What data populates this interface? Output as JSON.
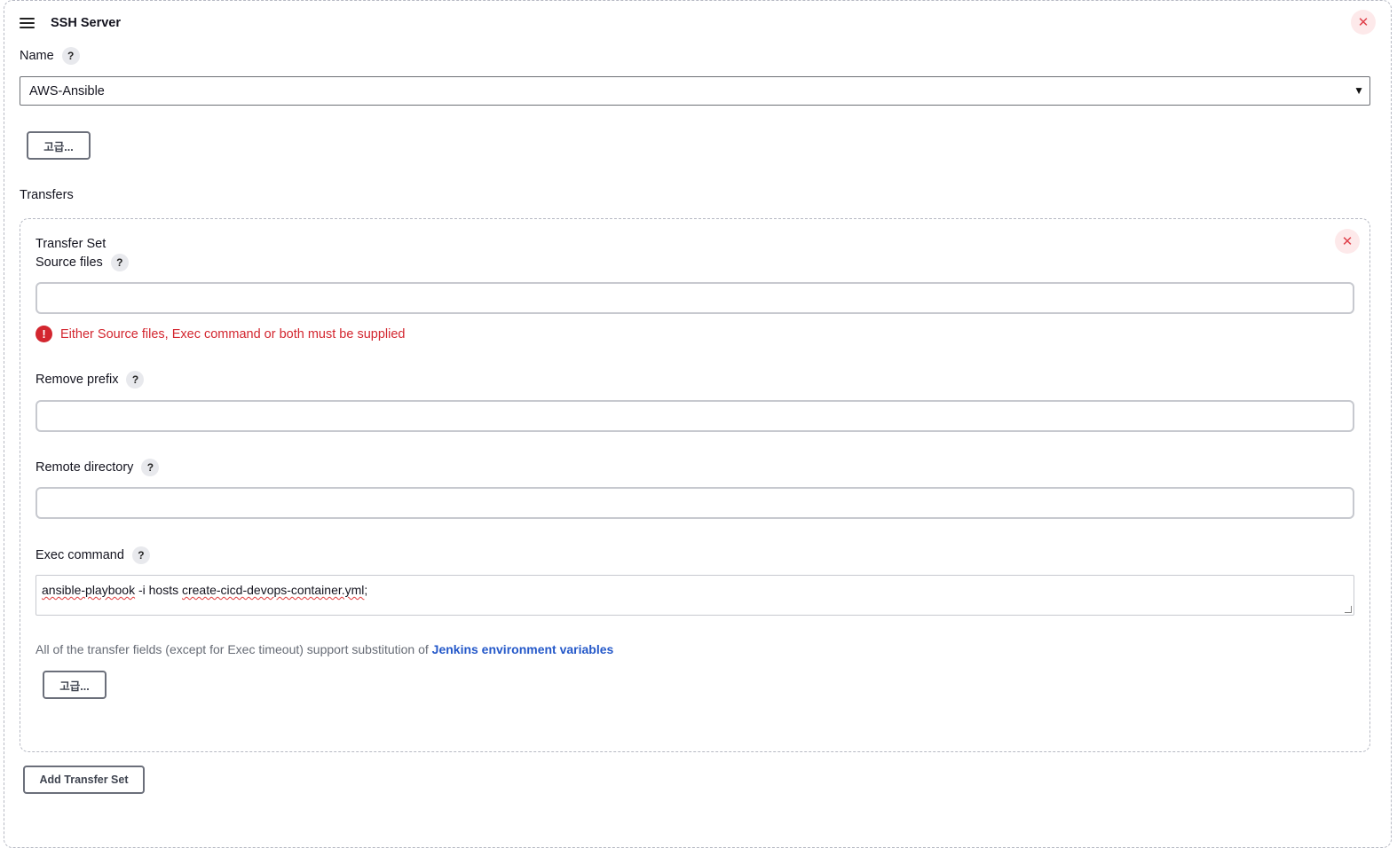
{
  "header": {
    "title": "SSH Server"
  },
  "name_field": {
    "label": "Name",
    "help": "?",
    "selected": "AWS-Ansible"
  },
  "advanced_label": "고급...",
  "transfers": {
    "title": "Transfers",
    "set_title": "Transfer Set",
    "source_files": {
      "label": "Source files",
      "help": "?",
      "value": ""
    },
    "error": {
      "icon": "!",
      "text": "Either Source files, Exec command or both must be supplied"
    },
    "remove_prefix": {
      "label": "Remove prefix",
      "help": "?",
      "value": ""
    },
    "remote_directory": {
      "label": "Remote directory",
      "help": "?",
      "value": ""
    },
    "exec_command": {
      "label": "Exec command",
      "help": "?",
      "value_parts": [
        "ansible-playbook",
        " -i hosts ",
        "create-cicd-devops-container.yml",
        ";"
      ]
    },
    "note_text": "All of the transfer fields (except for Exec timeout) support substitution of ",
    "note_link": "Jenkins environment variables",
    "advanced_label": "고급..."
  },
  "add_transfer_set": "Add Transfer Set",
  "icons": {
    "menu": "hamburger-icon",
    "close": "close-icon",
    "help": "question-icon",
    "error": "error-icon",
    "dropdown": "chevron-down-icon"
  },
  "colors": {
    "error": "#d3262f",
    "link": "#2458c9",
    "close_bg": "#fde9ea"
  }
}
